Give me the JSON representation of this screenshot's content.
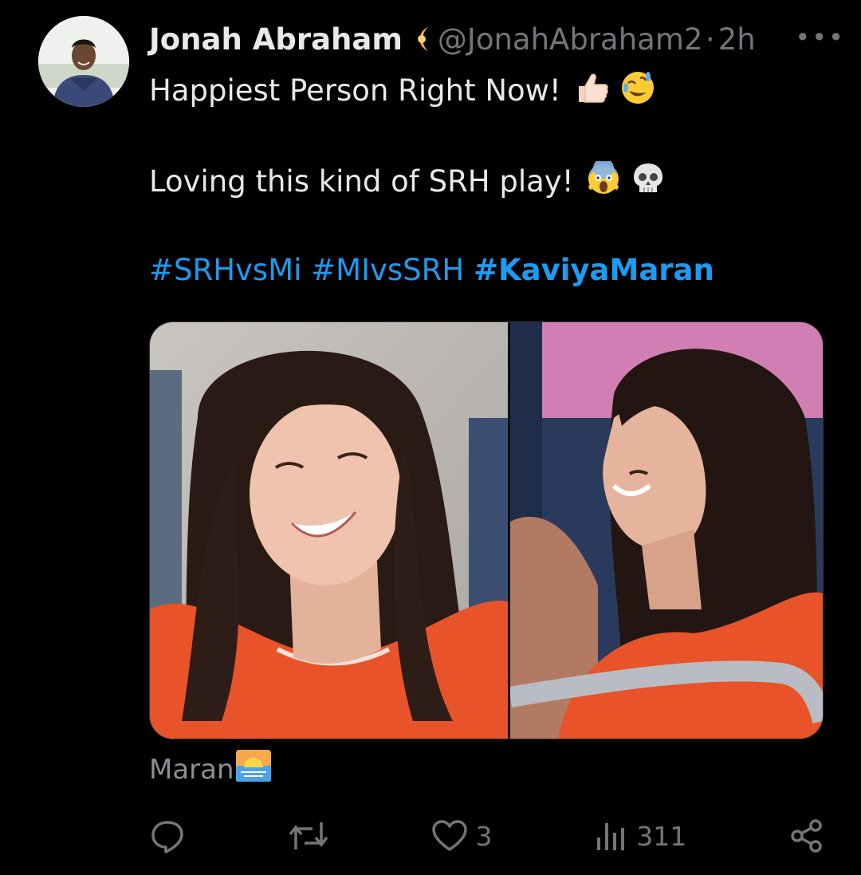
{
  "tweet": {
    "author_name": "Jonah Abraham",
    "handle": "@JonahAbraham2",
    "separator": "·",
    "time": "2h",
    "more_label": "•••",
    "lines": [
      "Happiest Person Right Now!",
      "Loving this kind of SRH play!"
    ],
    "hashtags": [
      "#SRHvsMi",
      "#MIvsSRH",
      "#KaviyaMaran"
    ],
    "media_caption": "Maran",
    "media": [
      "photo-smiling-woman-orange-shirt",
      "photo-smiling-woman-stadium"
    ]
  },
  "actions": {
    "reply_icon": "reply-icon",
    "retweet_icon": "retweet-icon",
    "like_icon": "heart-icon",
    "like_count": "3",
    "views_icon": "views-icon",
    "views_count": "311",
    "share_icon": "share-icon"
  },
  "colors": {
    "background": "#000000",
    "text": "#e7e9ea",
    "muted": "#71767b",
    "link": "#1d9bf0"
  }
}
